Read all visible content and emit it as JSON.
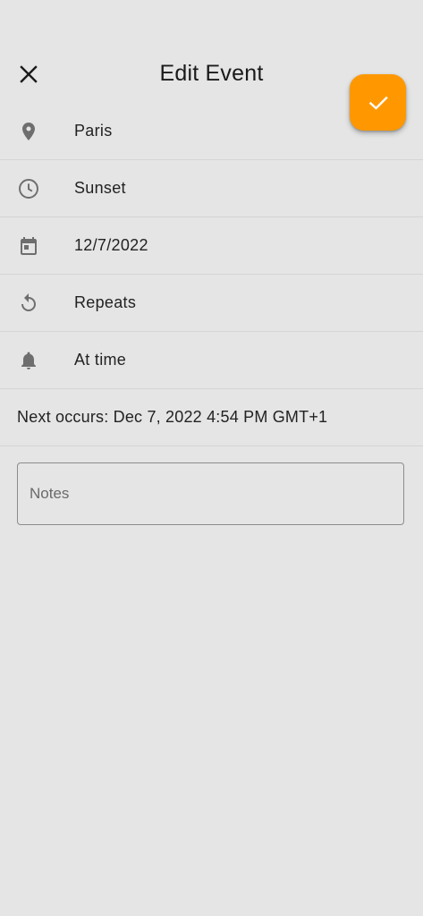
{
  "header": {
    "title": "Edit Event",
    "close_icon": "close-icon",
    "save_icon": "checkmark-icon"
  },
  "rows": [
    {
      "icon": "location-pin-icon",
      "label": "Paris"
    },
    {
      "icon": "clock-icon",
      "label": "Sunset"
    },
    {
      "icon": "calendar-icon",
      "label": "12/7/2022"
    },
    {
      "icon": "repeat-icon",
      "label": "Repeats"
    },
    {
      "icon": "bell-icon",
      "label": "At time"
    }
  ],
  "next_occurs": "Next occurs: Dec 7, 2022 4:54 PM GMT+1",
  "notes": {
    "placeholder": "Notes",
    "value": ""
  },
  "colors": {
    "accent": "#ff9800",
    "background": "#e4e5e4",
    "icon": "#6e6e6e",
    "divider": "#d4d5d4"
  }
}
